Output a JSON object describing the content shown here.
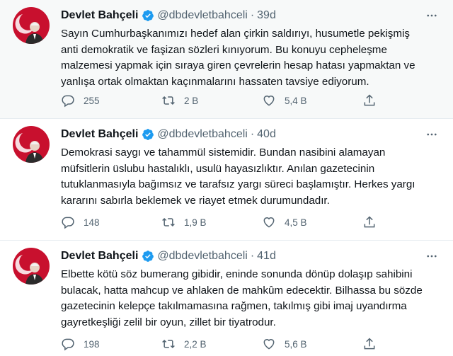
{
  "tweets": [
    {
      "name": "Devlet Bahçeli",
      "handle": "@dbdevletbahceli",
      "separator": "·",
      "time": "39d",
      "lines": [
        "Sayın Cumhurbaşkanımızı hedef alan çirkin saldırıyı, husumetle pekişmiş",
        "anti demokratik ve faşizan sözleri kınıyorum. Bu konuyu cepheleşme",
        "malzemesi yapmak için sıraya giren çevrelerin hesap hatası yapmaktan ve",
        "yanlışa ortak olmaktan kaçınmalarını hassaten tavsiye ediyorum."
      ],
      "replies": "255",
      "retweets": "2 B",
      "likes": "5,4 B"
    },
    {
      "name": "Devlet Bahçeli",
      "handle": "@dbdevletbahceli",
      "separator": "·",
      "time": "40d",
      "lines": [
        "Demokrasi saygı ve tahammül sistemidir. Bundan nasibini alamayan",
        "müfsitlerin üslubu hastalıklı, usulü hayasızlıktır. Anılan gazetecinin",
        "tutuklanmasıyla bağımsız ve tarafsız yargı süreci başlamıştır. Herkes yargı",
        "kararını sabırla beklemek ve riayet etmek durumundadır."
      ],
      "replies": "148",
      "retweets": "1,9 B",
      "likes": "4,5 B"
    },
    {
      "name": "Devlet Bahçeli",
      "handle": "@dbdevletbahceli",
      "separator": "·",
      "time": "41d",
      "lines": [
        "Elbette kötü söz bumerang gibidir, eninde sonunda dönüp dolaşıp sahibini",
        "bulacak, hatta mahcup ve ahlaken de mahkûm edecektir. Bilhassa bu sözde",
        "gazetecinin kelepçe takılmamasına rağmen, takılmış gibi imaj uyandırma",
        "gayretkeşliği zelil bir oyun, zillet bir tiyatrodur."
      ],
      "replies": "198",
      "retweets": "2,2 B",
      "likes": "5,6 B"
    }
  ],
  "icons": {
    "verified": "verified-badge-icon",
    "more": "more-options-icon",
    "reply": "reply-icon",
    "retweet": "retweet-icon",
    "like": "heart-icon",
    "share": "share-icon"
  },
  "colors": {
    "verified": "#1d9bf0",
    "text": "#0f1419",
    "secondary": "#536471",
    "avatar_bg": "#c8102e"
  }
}
